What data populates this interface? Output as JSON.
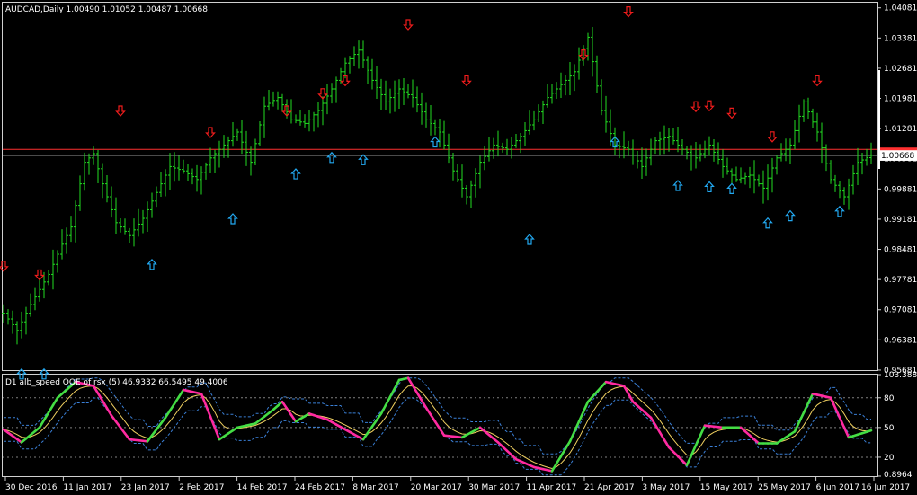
{
  "main_title": "AUDCAD,Daily  1.00490 1.01052 1.00487 1.00668",
  "indicator_title": "D1 alb_speed QQE of rsx (5) 46.9332 66.5495 49.4006",
  "current_price_label": "1.00668",
  "colors": {
    "background": "#000000",
    "bars": "#22dd22",
    "up_arrow": "#22a8f0",
    "down_arrow": "#ee1c1c",
    "red_line": "#ff3030",
    "white_line": "#c8c8c8",
    "price_tag_bg": "#ffffff",
    "qqe_up": "#44dd44",
    "qqe_down": "#ff2aa0",
    "signal": "#f0d060",
    "band": "#3a7fd6",
    "level": "#808080"
  },
  "chart_data": [
    {
      "type": "ohlc",
      "symbol": "AUDCAD",
      "timeframe": "Daily",
      "ylim": [
        0.9568,
        1.042
      ],
      "y_ticks": [
        "1.04081",
        "1.03381",
        "1.02681",
        "1.01981",
        "1.01281",
        "1.00581",
        "0.99881",
        "0.99181",
        "0.98481",
        "0.97781",
        "0.97081",
        "0.96381",
        "0.95681"
      ],
      "x_ticks": [
        "30 Dec 2016",
        "11 Jan 2017",
        "23 Jan 2017",
        "2 Feb 2017",
        "14 Feb 2017",
        "24 Feb 2017",
        "8 Mar 2017",
        "20 Mar 2017",
        "30 Mar 2017",
        "11 Apr 2017",
        "21 Apr 2017",
        "3 May 2017",
        "15 May 2017",
        "25 May 2017",
        "6 Jun 2017",
        "16 Jun 2017"
      ],
      "horizontal_lines": {
        "red": 1.008,
        "white": 1.0066
      },
      "close_anchors": [
        [
          0,
          0.97
        ],
        [
          3,
          0.966
        ],
        [
          6,
          0.972
        ],
        [
          10,
          0.979
        ],
        [
          13,
          0.986
        ],
        [
          15,
          0.99
        ],
        [
          18,
          1.005
        ],
        [
          20,
          1.007
        ],
        [
          22,
          1.0
        ],
        [
          25,
          0.991
        ],
        [
          28,
          0.988
        ],
        [
          31,
          0.992
        ],
        [
          34,
          0.998
        ],
        [
          37,
          1.004
        ],
        [
          40,
          1.003
        ],
        [
          43,
          1.001
        ],
        [
          46,
          1.006
        ],
        [
          49,
          1.009
        ],
        [
          52,
          1.012
        ],
        [
          55,
          1.005
        ],
        [
          58,
          1.018
        ],
        [
          61,
          1.02
        ],
        [
          64,
          1.015
        ],
        [
          67,
          1.014
        ],
        [
          70,
          1.017
        ],
        [
          73,
          1.022
        ],
        [
          76,
          1.028
        ],
        [
          79,
          1.031
        ],
        [
          82,
          1.024
        ],
        [
          85,
          1.019
        ],
        [
          88,
          1.022
        ],
        [
          91,
          1.02
        ],
        [
          94,
          1.015
        ],
        [
          97,
          1.012
        ],
        [
          100,
          1.003
        ],
        [
          103,
          0.997
        ],
        [
          106,
          1.005
        ],
        [
          109,
          1.009
        ],
        [
          112,
          1.008
        ],
        [
          115,
          1.011
        ],
        [
          118,
          1.015
        ],
        [
          121,
          1.02
        ],
        [
          124,
          1.023
        ],
        [
          127,
          1.026
        ],
        [
          130,
          1.034
        ],
        [
          133,
          1.017
        ],
        [
          136,
          1.009
        ],
        [
          139,
          1.008
        ],
        [
          142,
          1.004
        ],
        [
          145,
          1.01
        ],
        [
          148,
          1.011
        ],
        [
          151,
          1.008
        ],
        [
          154,
          1.006
        ],
        [
          157,
          1.009
        ],
        [
          160,
          1.004
        ],
        [
          163,
          1.001
        ],
        [
          166,
          1.002
        ],
        [
          169,
          0.999
        ],
        [
          172,
          1.006
        ],
        [
          175,
          1.009
        ],
        [
          178,
          1.019
        ],
        [
          181,
          1.012
        ],
        [
          184,
          1.001
        ],
        [
          187,
          0.997
        ],
        [
          190,
          1.005
        ],
        [
          193,
          1.0066
        ]
      ],
      "up_arrows": [
        {
          "i": 4,
          "price": 0.9558
        },
        {
          "i": 9,
          "price": 0.9558
        },
        {
          "i": 33,
          "price": 0.9812
        },
        {
          "i": 51,
          "price": 0.9918
        },
        {
          "i": 65,
          "price": 1.0022
        },
        {
          "i": 73,
          "price": 1.006
        },
        {
          "i": 80,
          "price": 1.0055
        },
        {
          "i": 96,
          "price": 1.0096
        },
        {
          "i": 117,
          "price": 0.987
        },
        {
          "i": 136,
          "price": 1.0096
        },
        {
          "i": 150,
          "price": 0.9995
        },
        {
          "i": 157,
          "price": 0.9992
        },
        {
          "i": 162,
          "price": 0.9988
        },
        {
          "i": 170,
          "price": 0.9908
        },
        {
          "i": 175,
          "price": 0.9925
        },
        {
          "i": 186,
          "price": 0.9935
        }
      ],
      "down_arrows": [
        {
          "i": 0,
          "price": 0.981
        },
        {
          "i": 8,
          "price": 0.979
        },
        {
          "i": 26,
          "price": 1.017
        },
        {
          "i": 46,
          "price": 1.012
        },
        {
          "i": 63,
          "price": 1.017
        },
        {
          "i": 71,
          "price": 1.021
        },
        {
          "i": 76,
          "price": 1.024
        },
        {
          "i": 90,
          "price": 1.037
        },
        {
          "i": 103,
          "price": 1.024
        },
        {
          "i": 129,
          "price": 1.03
        },
        {
          "i": 139,
          "price": 1.04
        },
        {
          "i": 154,
          "price": 1.018
        },
        {
          "i": 157,
          "price": 1.0182
        },
        {
          "i": 162,
          "price": 1.0165
        },
        {
          "i": 171,
          "price": 1.011
        },
        {
          "i": 181,
          "price": 1.024
        }
      ]
    },
    {
      "type": "line",
      "title": "D1 alb_speed QQE of rsx (5) 46.9332 66.5495 49.4006",
      "ylim": [
        0.8964,
        103.3882
      ],
      "y_ticks": [
        "103.3882",
        "80",
        "50",
        "20",
        "0.8964"
      ],
      "levels": [
        80,
        50,
        20
      ],
      "rsx_anchors": [
        [
          0,
          48
        ],
        [
          4,
          35
        ],
        [
          8,
          50
        ],
        [
          12,
          80
        ],
        [
          16,
          96
        ],
        [
          20,
          92
        ],
        [
          24,
          62
        ],
        [
          28,
          38
        ],
        [
          32,
          36
        ],
        [
          36,
          60
        ],
        [
          40,
          88
        ],
        [
          44,
          84
        ],
        [
          48,
          38
        ],
        [
          52,
          50
        ],
        [
          56,
          54
        ],
        [
          60,
          68
        ],
        [
          62,
          76
        ],
        [
          65,
          56
        ],
        [
          68,
          64
        ],
        [
          72,
          58
        ],
        [
          76,
          48
        ],
        [
          80,
          38
        ],
        [
          84,
          64
        ],
        [
          88,
          98
        ],
        [
          90,
          100
        ],
        [
          94,
          70
        ],
        [
          98,
          42
        ],
        [
          102,
          40
        ],
        [
          106,
          50
        ],
        [
          110,
          35
        ],
        [
          114,
          18
        ],
        [
          118,
          10
        ],
        [
          122,
          6
        ],
        [
          126,
          36
        ],
        [
          130,
          76
        ],
        [
          134,
          96
        ],
        [
          138,
          92
        ],
        [
          140,
          76
        ],
        [
          144,
          60
        ],
        [
          148,
          30
        ],
        [
          152,
          12
        ],
        [
          156,
          52
        ],
        [
          160,
          50
        ],
        [
          164,
          50
        ],
        [
          168,
          34
        ],
        [
          172,
          34
        ],
        [
          176,
          46
        ],
        [
          180,
          84
        ],
        [
          184,
          80
        ],
        [
          188,
          40
        ],
        [
          193,
          47
        ]
      ]
    }
  ]
}
